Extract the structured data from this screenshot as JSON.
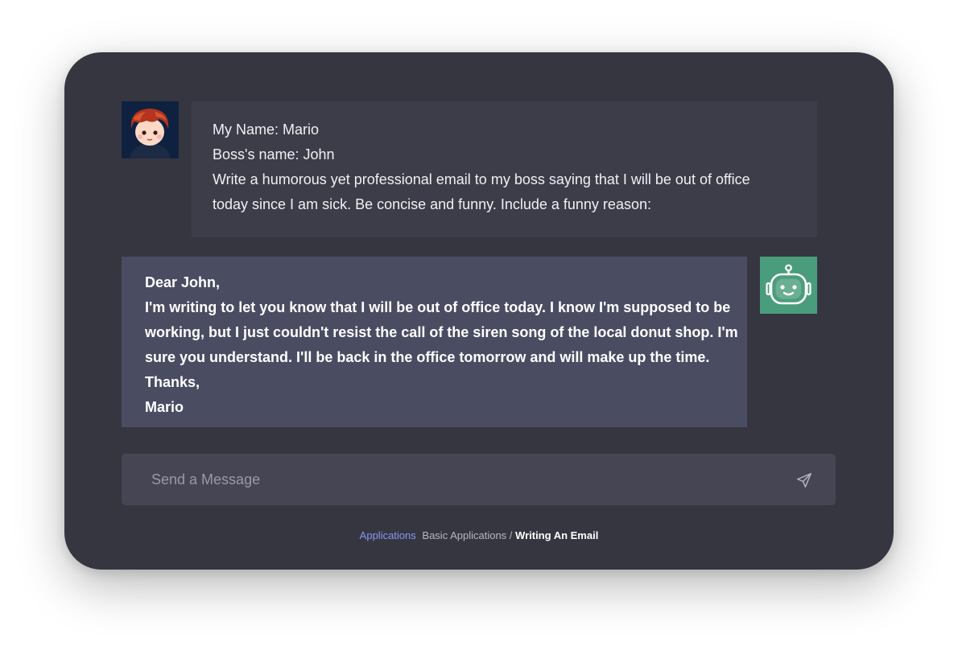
{
  "user_message": {
    "lines": [
      "My Name: Mario",
      "Boss's name: John",
      "Write a humorous yet professional email to my boss saying that I will be out of office",
      "today since I am sick. Be concise and funny. Include a funny reason:"
    ]
  },
  "bot_message": {
    "lines": [
      "Dear John,",
      "I'm writing to let you know that I will be out of office today. I know I'm supposed to be",
      "working, but I just couldn't resist the call of the siren song of the local donut shop. I'm",
      "sure you understand. I'll be back in the office tomorrow and will make up the time.",
      "Thanks,",
      "Mario"
    ]
  },
  "input": {
    "placeholder": "Send a Message",
    "value": ""
  },
  "breadcrumb": {
    "root": "Applications",
    "section": "Basic Applications",
    "separator": " / ",
    "current": "Writing An Email"
  },
  "icons": {
    "user_avatar": "user-avatar-icon",
    "bot_avatar": "robot-icon",
    "send": "send-icon"
  },
  "colors": {
    "card_background": "#363641",
    "user_bubble": "#3d3d4a",
    "bot_bubble": "#4a4d62",
    "bot_avatar": "#4a9d7c",
    "link_accent": "#8a96f2"
  }
}
